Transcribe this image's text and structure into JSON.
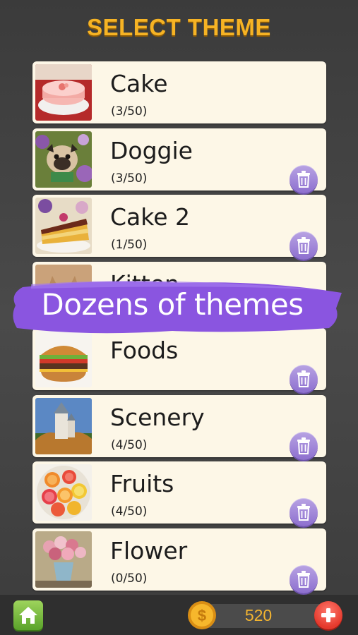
{
  "header": {
    "title": "SELECT THEME"
  },
  "themes": [
    {
      "name": "Cake",
      "progress": "(3/50)",
      "deletable": false,
      "image_icon": "cake-photo"
    },
    {
      "name": "Doggie",
      "progress": "(3/50)",
      "deletable": true,
      "image_icon": "pug-photo"
    },
    {
      "name": "Cake 2",
      "progress": "(1/50)",
      "deletable": true,
      "image_icon": "cake-slice-photo"
    },
    {
      "name": "Kitten",
      "progress": "",
      "deletable": true,
      "image_icon": "kitten-photo"
    },
    {
      "name": "Foods",
      "progress": "",
      "deletable": true,
      "image_icon": "burger-photo"
    },
    {
      "name": "Scenery",
      "progress": "(4/50)",
      "deletable": true,
      "image_icon": "castle-photo"
    },
    {
      "name": "Fruits",
      "progress": "(4/50)",
      "deletable": true,
      "image_icon": "citrus-photo"
    },
    {
      "name": "Flower",
      "progress": "(0/50)",
      "deletable": true,
      "image_icon": "flower-vase-photo"
    }
  ],
  "promo_banner": {
    "text": "Dozens of themes",
    "color": "#8a55e0"
  },
  "footer": {
    "home_icon": "home-icon",
    "coin_icon": "coin-icon",
    "coins": "520",
    "add_icon": "plus-icon"
  },
  "colors": {
    "title": "#f6b324",
    "card_bg": "#fdf7e7",
    "trash_button": "#9b80d6",
    "coin_text": "#f3b430"
  }
}
